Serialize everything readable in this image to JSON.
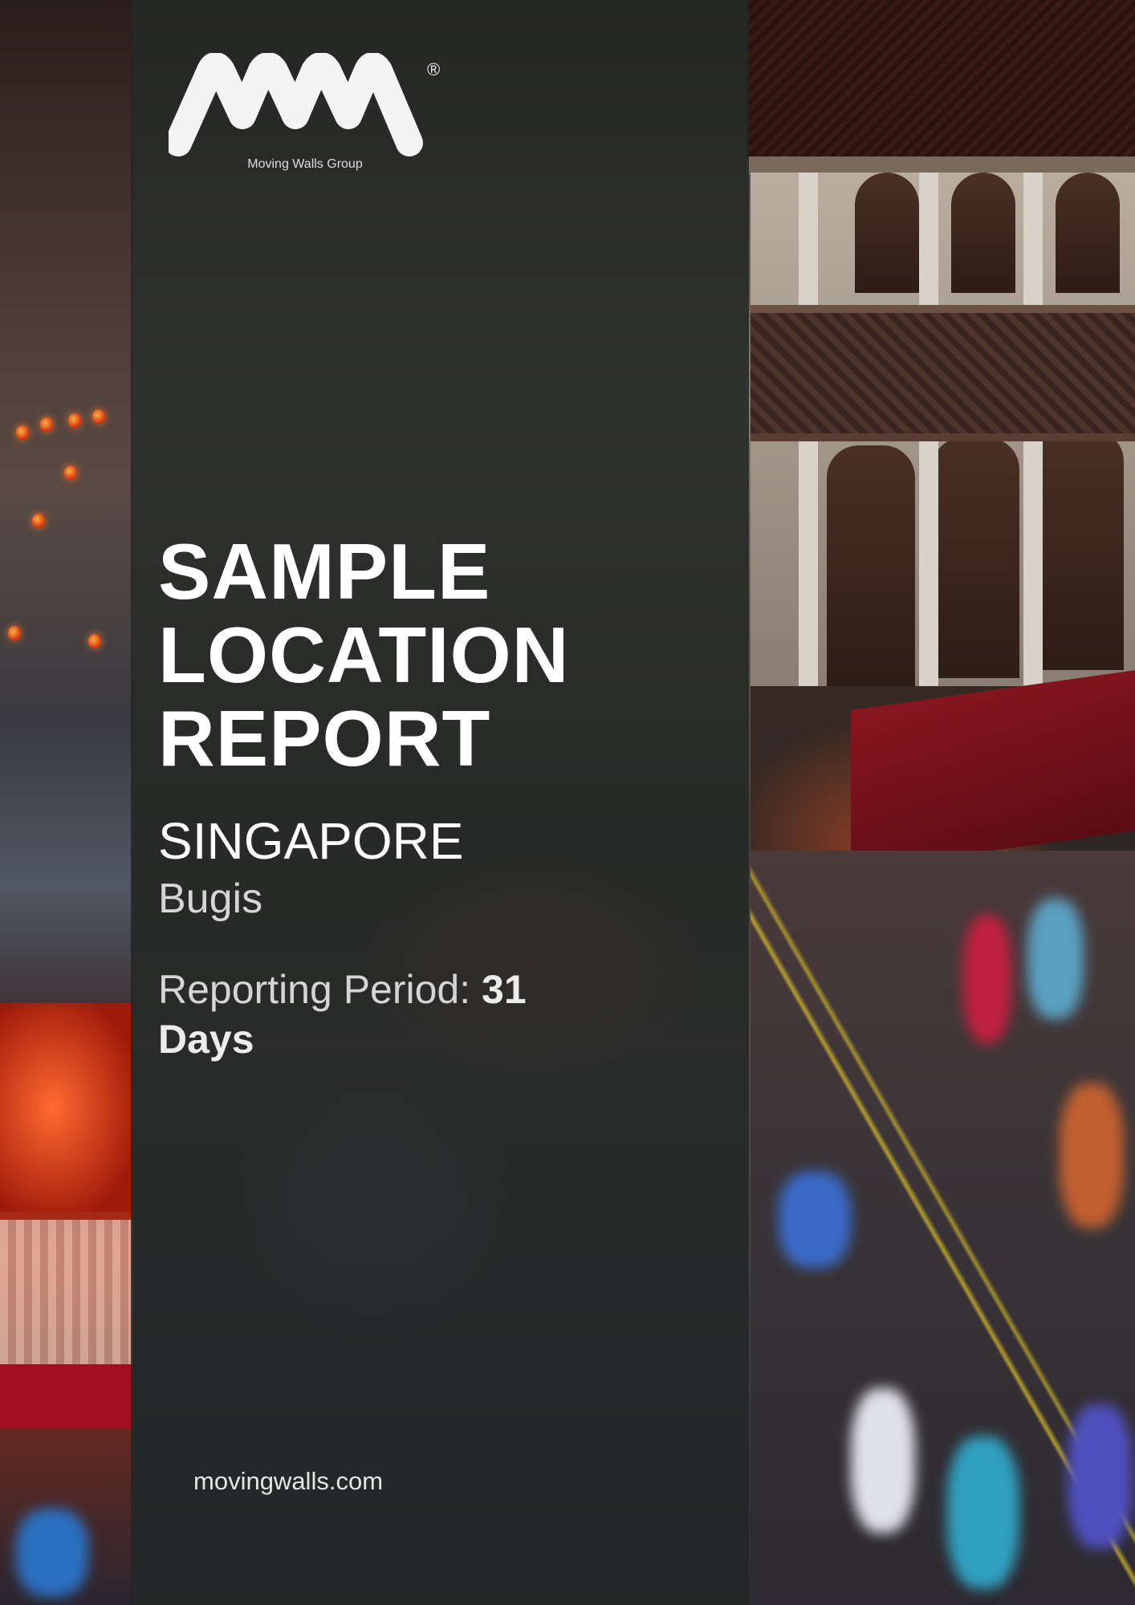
{
  "logo": {
    "icon": "mw-logo-icon",
    "mark": "MW",
    "registered": "®",
    "tagline": "Moving Walls Group"
  },
  "title": {
    "line1": "SAMPLE",
    "line2": "LOCATION",
    "line3": "REPORT"
  },
  "location": {
    "country": "SINGAPORE",
    "city": "Bugis"
  },
  "period": {
    "label": "Reporting Period:",
    "value": "31",
    "unit": "Days"
  },
  "footer": {
    "website": "movingwalls.com"
  },
  "colors": {
    "panel": "#222625",
    "text": "#ffffff",
    "muted": "#d5d5d5"
  }
}
